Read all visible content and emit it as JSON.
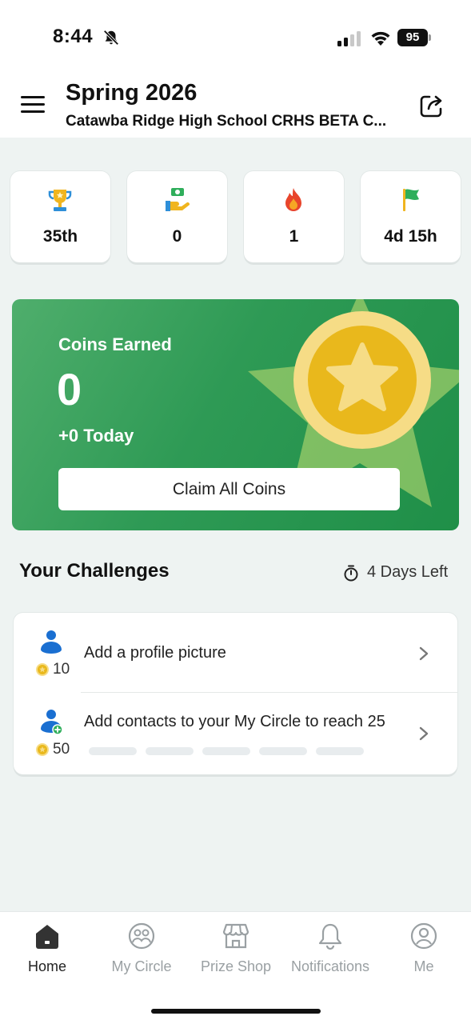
{
  "status_bar": {
    "time": "8:44",
    "battery": "95"
  },
  "header": {
    "title": "Spring 2026",
    "subtitle": "Catawba Ridge High School CRHS BETA C..."
  },
  "stats": [
    {
      "icon": "trophy-icon",
      "value": "35th"
    },
    {
      "icon": "coin-hand-icon",
      "value": "0"
    },
    {
      "icon": "flame-icon",
      "value": "1"
    },
    {
      "icon": "flag-icon",
      "value": "4d 15h"
    }
  ],
  "coins": {
    "label": "Coins Earned",
    "amount": "0",
    "today": "+0 Today",
    "claim_label": "Claim All Coins"
  },
  "challenges": {
    "title": "Your Challenges",
    "time_left": "4 Days Left",
    "items": [
      {
        "text": "Add a profile picture",
        "points": "10"
      },
      {
        "text": "Add contacts to your My Circle to reach 25",
        "points": "50",
        "progress_segments_done": 0,
        "progress_segments_total": 5
      }
    ]
  },
  "nav": {
    "items": [
      {
        "label": "Home",
        "icon": "home-icon",
        "active": true
      },
      {
        "label": "My Circle",
        "icon": "circle-people-icon",
        "active": false
      },
      {
        "label": "Prize Shop",
        "icon": "shop-icon",
        "active": false
      },
      {
        "label": "Notifications",
        "icon": "bell-icon",
        "active": false
      },
      {
        "label": "Me",
        "icon": "profile-icon",
        "active": false
      }
    ]
  },
  "colors": {
    "accent_green": "#2e9a55",
    "coin_gold": "#e9b81c",
    "person_blue": "#1a6fd1",
    "background": "#eef3f2"
  }
}
